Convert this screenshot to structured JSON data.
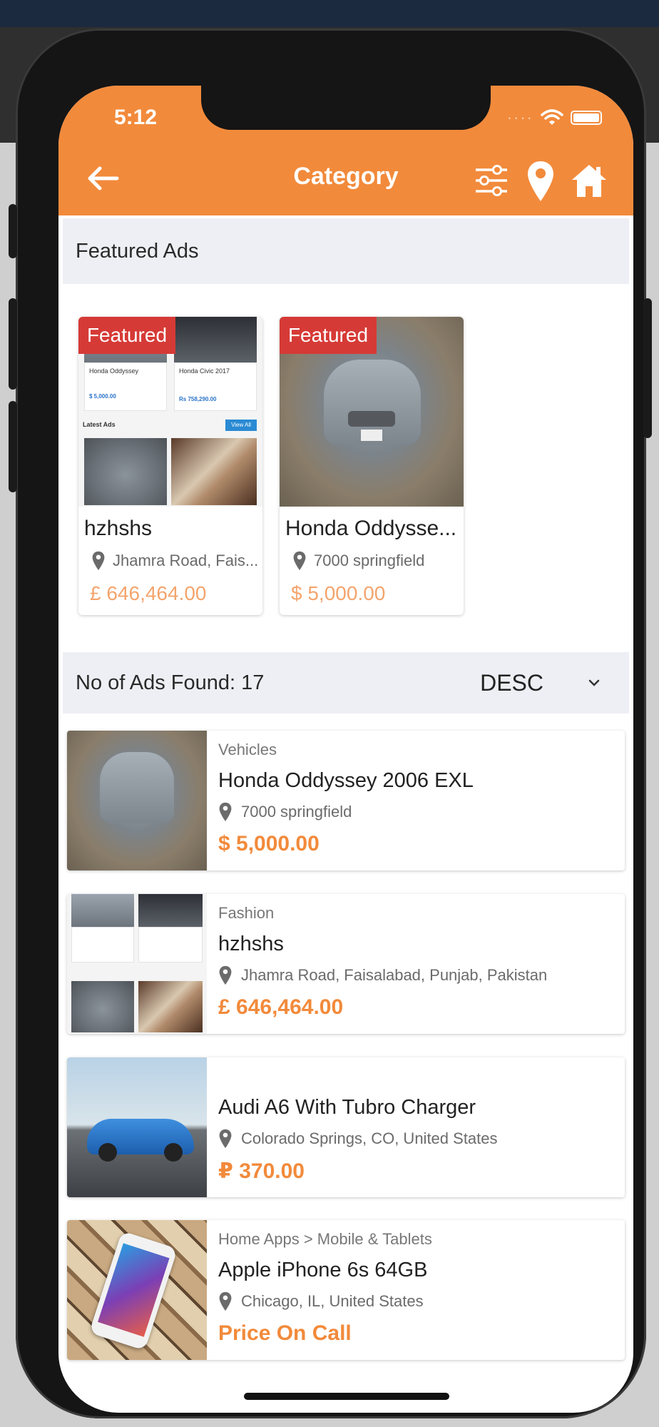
{
  "status_bar": {
    "time": "5:12"
  },
  "header": {
    "title": "Category",
    "icons": [
      "back-arrow-icon",
      "filter-sliders-icon",
      "location-pin-icon",
      "home-icon"
    ]
  },
  "featured": {
    "section_title": "Featured Ads",
    "badge": "Featured",
    "items": [
      {
        "title": "hzhshs",
        "location": "Jhamra Road, Fais...",
        "price": "£ 646,464.00"
      },
      {
        "title": "Honda Oddysse...",
        "location": "7000 springfield",
        "price": "$ 5,000.00"
      }
    ],
    "screenshot_thumb": {
      "item1": "Honda Oddyssey",
      "item2": "Honda Civic 2017",
      "price1": "$ 5,000.00",
      "price2": "Rs 758,290.00",
      "latest": "Latest Ads",
      "view_all": "View All"
    }
  },
  "results": {
    "count_label": "No of Ads Found: 17",
    "sort_value": "DESC"
  },
  "listings": [
    {
      "category": "Vehicles",
      "title": "Honda Oddyssey 2006 EXL",
      "location": "7000 springfield",
      "price": "$ 5,000.00"
    },
    {
      "category": "Fashion",
      "title": "hzhshs",
      "location": "Jhamra Road, Faisalabad, Punjab, Pakistan",
      "price": "£ 646,464.00"
    },
    {
      "category": "",
      "title": "Audi A6 With Tubro Charger",
      "location": "Colorado Springs, CO, United States",
      "price": "₽ 370.00"
    },
    {
      "category": "Home Apps > Mobile & Tablets",
      "title": "Apple iPhone 6s 64GB",
      "location": "Chicago, IL, United States",
      "price": "Price On Call"
    }
  ],
  "colors": {
    "primary": "#f28a3b",
    "badge": "#d63a36",
    "featured_price": "#f4a46d",
    "section_bg": "#eeeff4"
  }
}
